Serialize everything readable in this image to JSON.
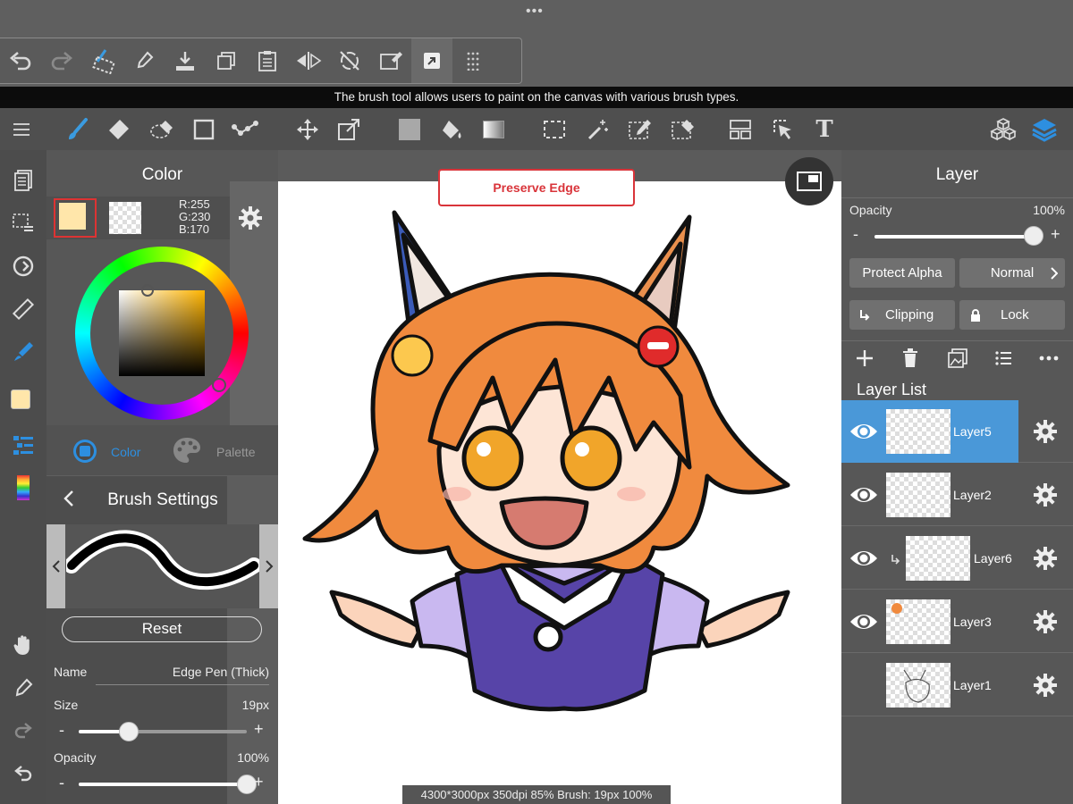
{
  "app": {
    "window_dots": "•••"
  },
  "quick_toolbar": {
    "icons": [
      "undo-icon",
      "redo-icon",
      "transform-select-icon",
      "eyedropper-icon",
      "save-icon",
      "copy-icon",
      "paste-icon",
      "flip-icon",
      "rotate-reset-icon",
      "clear-icon",
      "snap-icon",
      "grid-dots-icon"
    ]
  },
  "tooltip": {
    "text": "The brush tool allows users to paint on the canvas with various brush types."
  },
  "main_toolbar": {
    "tools": [
      "brush",
      "eraser",
      "lasso-eraser",
      "shape",
      "dot",
      "move",
      "transform",
      "fill-color",
      "bucket",
      "gradient",
      "select",
      "magic-wand",
      "select-pen",
      "select-eraser",
      "layout",
      "select-cursor",
      "text"
    ],
    "right": [
      "materials",
      "layers"
    ]
  },
  "color_panel": {
    "title": "Color",
    "main_color": "#FFE6AA",
    "r_label": "R:255",
    "g_label": "G:230",
    "b_label": "B:170",
    "tab_color": "Color",
    "tab_palette": "Palette"
  },
  "brush_panel": {
    "title": "Brush Settings",
    "reset": "Reset",
    "name_label": "Name",
    "name_value": "Edge Pen (Thick)",
    "size_label": "Size",
    "size_value": "19px",
    "size_fraction": 0.3,
    "opacity_label": "Opacity",
    "opacity_value": "100%",
    "opacity_fraction": 1.0,
    "minus": "-",
    "plus": "+"
  },
  "canvas": {
    "preserve_edge": "Preserve Edge",
    "status": "4300*3000px 350dpi 85% Brush: 19px 100%"
  },
  "layer_panel": {
    "title": "Layer",
    "opacity_label": "Opacity",
    "opacity_value": "100%",
    "opacity_fraction": 1.0,
    "minus": "-",
    "plus": "+",
    "protect_alpha": "Protect Alpha",
    "blend_mode": "Normal",
    "clipping": "Clipping",
    "lock": "Lock",
    "list_title": "Layer List",
    "layers": [
      {
        "name": "Layer5",
        "selected": true,
        "visible": true
      },
      {
        "name": "Layer2",
        "selected": false,
        "visible": true
      },
      {
        "name": "Layer6",
        "selected": false,
        "visible": true,
        "clipped": true
      },
      {
        "name": "Layer3",
        "selected": false,
        "visible": true
      },
      {
        "name": "Layer1",
        "selected": false,
        "visible": false
      }
    ]
  },
  "colors": {
    "accent": "#2d8fe0",
    "selected_layer": "#4a98d8",
    "preserve_edge_red": "#d9343a"
  }
}
